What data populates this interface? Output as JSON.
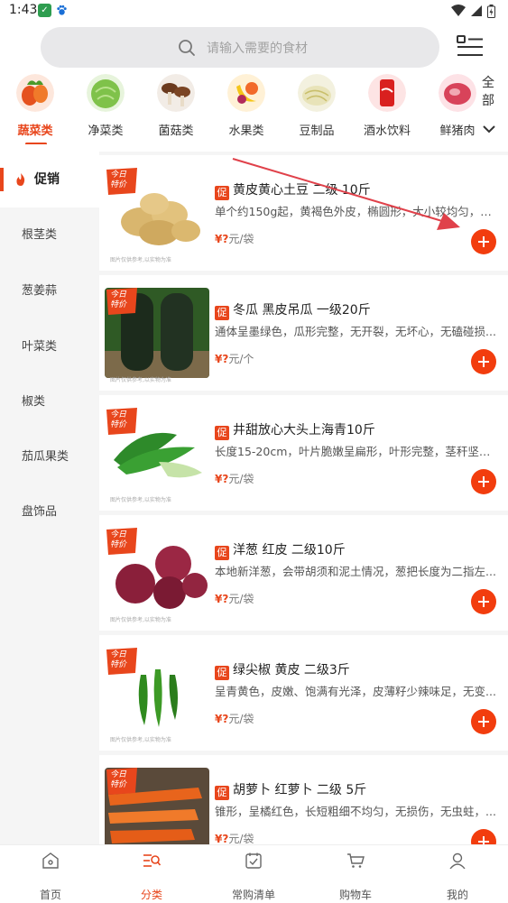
{
  "status_bar": {
    "time": "1:43"
  },
  "search": {
    "placeholder": "请输入需要的食材"
  },
  "categories": [
    {
      "label": "蔬菜类",
      "icon": "vegetables-image"
    },
    {
      "label": "净菜类",
      "icon": "cabbage-image"
    },
    {
      "label": "菌菇类",
      "icon": "mushroom-image"
    },
    {
      "label": "水果类",
      "icon": "fruit-image"
    },
    {
      "label": "豆制品",
      "icon": "bean-sprout-image"
    },
    {
      "label": "酒水饮料",
      "icon": "cola-image"
    },
    {
      "label": "鲜猪肉",
      "icon": "pork-image"
    }
  ],
  "all_button": {
    "label": "全部"
  },
  "side_menu": [
    {
      "label": "促销"
    },
    {
      "label": "根茎类"
    },
    {
      "label": "葱姜蒜"
    },
    {
      "label": "叶菜类"
    },
    {
      "label": "椒类"
    },
    {
      "label": "茄瓜果类"
    },
    {
      "label": "盘饰品"
    }
  ],
  "promo_tag": "促",
  "today_tag": [
    "今日",
    "特价"
  ],
  "image_note": "图片仅供参考,以实物为准",
  "products": [
    {
      "name": "黄皮黄心土豆 二级 10斤",
      "desc": "单个约150g起，黄褐色外皮，椭圆形，大小较均匀，无...",
      "price": "¥?",
      "unit": "元/袋"
    },
    {
      "name": "冬瓜 黑皮吊瓜 一级20斤",
      "desc": "通体呈墨绿色，瓜形完整，无开裂，无坏心，无磕碰损...",
      "price": "¥?",
      "unit": "元/个"
    },
    {
      "name": "井甜放心大头上海青10斤",
      "desc": "长度15-20cm，叶片脆嫩呈扁形，叶形完整，茎秆坚挺...",
      "price": "¥?",
      "unit": "元/袋"
    },
    {
      "name": "洋葱 红皮 二级10斤",
      "desc": "本地新洋葱，会带胡须和泥土情况，葱把长度为二指左...",
      "price": "¥?",
      "unit": "元/袋"
    },
    {
      "name": "绿尖椒 黄皮 二级3斤",
      "desc": "呈青黄色，皮嫩、饱满有光泽，皮薄籽少辣味足，无变...",
      "price": "¥?",
      "unit": "元/袋"
    },
    {
      "name": "胡萝卜 红萝卜 二级 5斤",
      "desc": "锥形，呈橘红色，长短粗细不均匀，无损伤，无虫蛀，...",
      "price": "¥?",
      "unit": "元/袋"
    }
  ],
  "tabs": [
    {
      "label": "首页"
    },
    {
      "label": "分类"
    },
    {
      "label": "常购清单"
    },
    {
      "label": "购物车"
    },
    {
      "label": "我的"
    }
  ],
  "colors": {
    "accent": "#e8461c",
    "add_button": "#f23d0e",
    "side_bg": "#f5f5f5"
  }
}
